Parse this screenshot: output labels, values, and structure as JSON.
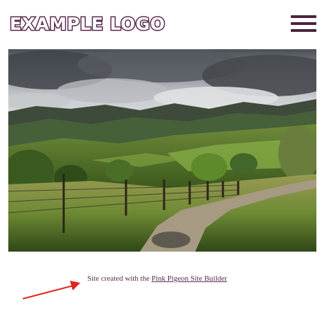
{
  "header": {
    "logo_text": "EXAMPLE LOGO",
    "menu_icon": "hamburger-menu-icon"
  },
  "hero": {
    "image_name": "landscape-photo"
  },
  "footer": {
    "prefix": "Site created with the ",
    "link_text": "Pink Pigeon Site Builder"
  },
  "colors": {
    "brand": "#5a2a4d",
    "arrow": "#e0251f"
  }
}
